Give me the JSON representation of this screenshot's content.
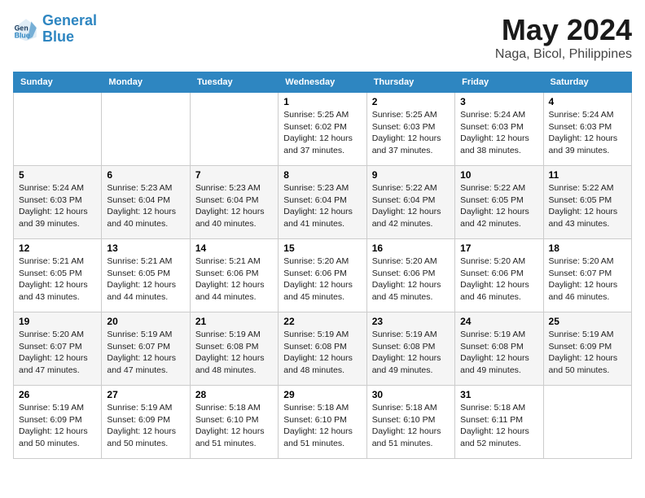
{
  "logo": {
    "line1": "General",
    "line2": "Blue"
  },
  "title": "May 2024",
  "subtitle": "Naga, Bicol, Philippines",
  "headers": [
    "Sunday",
    "Monday",
    "Tuesday",
    "Wednesday",
    "Thursday",
    "Friday",
    "Saturday"
  ],
  "weeks": [
    [
      {
        "day": "",
        "info": ""
      },
      {
        "day": "",
        "info": ""
      },
      {
        "day": "",
        "info": ""
      },
      {
        "day": "1",
        "info": "Sunrise: 5:25 AM\nSunset: 6:02 PM\nDaylight: 12 hours\nand 37 minutes."
      },
      {
        "day": "2",
        "info": "Sunrise: 5:25 AM\nSunset: 6:03 PM\nDaylight: 12 hours\nand 37 minutes."
      },
      {
        "day": "3",
        "info": "Sunrise: 5:24 AM\nSunset: 6:03 PM\nDaylight: 12 hours\nand 38 minutes."
      },
      {
        "day": "4",
        "info": "Sunrise: 5:24 AM\nSunset: 6:03 PM\nDaylight: 12 hours\nand 39 minutes."
      }
    ],
    [
      {
        "day": "5",
        "info": "Sunrise: 5:24 AM\nSunset: 6:03 PM\nDaylight: 12 hours\nand 39 minutes."
      },
      {
        "day": "6",
        "info": "Sunrise: 5:23 AM\nSunset: 6:04 PM\nDaylight: 12 hours\nand 40 minutes."
      },
      {
        "day": "7",
        "info": "Sunrise: 5:23 AM\nSunset: 6:04 PM\nDaylight: 12 hours\nand 40 minutes."
      },
      {
        "day": "8",
        "info": "Sunrise: 5:23 AM\nSunset: 6:04 PM\nDaylight: 12 hours\nand 41 minutes."
      },
      {
        "day": "9",
        "info": "Sunrise: 5:22 AM\nSunset: 6:04 PM\nDaylight: 12 hours\nand 42 minutes."
      },
      {
        "day": "10",
        "info": "Sunrise: 5:22 AM\nSunset: 6:05 PM\nDaylight: 12 hours\nand 42 minutes."
      },
      {
        "day": "11",
        "info": "Sunrise: 5:22 AM\nSunset: 6:05 PM\nDaylight: 12 hours\nand 43 minutes."
      }
    ],
    [
      {
        "day": "12",
        "info": "Sunrise: 5:21 AM\nSunset: 6:05 PM\nDaylight: 12 hours\nand 43 minutes."
      },
      {
        "day": "13",
        "info": "Sunrise: 5:21 AM\nSunset: 6:05 PM\nDaylight: 12 hours\nand 44 minutes."
      },
      {
        "day": "14",
        "info": "Sunrise: 5:21 AM\nSunset: 6:06 PM\nDaylight: 12 hours\nand 44 minutes."
      },
      {
        "day": "15",
        "info": "Sunrise: 5:20 AM\nSunset: 6:06 PM\nDaylight: 12 hours\nand 45 minutes."
      },
      {
        "day": "16",
        "info": "Sunrise: 5:20 AM\nSunset: 6:06 PM\nDaylight: 12 hours\nand 45 minutes."
      },
      {
        "day": "17",
        "info": "Sunrise: 5:20 AM\nSunset: 6:06 PM\nDaylight: 12 hours\nand 46 minutes."
      },
      {
        "day": "18",
        "info": "Sunrise: 5:20 AM\nSunset: 6:07 PM\nDaylight: 12 hours\nand 46 minutes."
      }
    ],
    [
      {
        "day": "19",
        "info": "Sunrise: 5:20 AM\nSunset: 6:07 PM\nDaylight: 12 hours\nand 47 minutes."
      },
      {
        "day": "20",
        "info": "Sunrise: 5:19 AM\nSunset: 6:07 PM\nDaylight: 12 hours\nand 47 minutes."
      },
      {
        "day": "21",
        "info": "Sunrise: 5:19 AM\nSunset: 6:08 PM\nDaylight: 12 hours\nand 48 minutes."
      },
      {
        "day": "22",
        "info": "Sunrise: 5:19 AM\nSunset: 6:08 PM\nDaylight: 12 hours\nand 48 minutes."
      },
      {
        "day": "23",
        "info": "Sunrise: 5:19 AM\nSunset: 6:08 PM\nDaylight: 12 hours\nand 49 minutes."
      },
      {
        "day": "24",
        "info": "Sunrise: 5:19 AM\nSunset: 6:08 PM\nDaylight: 12 hours\nand 49 minutes."
      },
      {
        "day": "25",
        "info": "Sunrise: 5:19 AM\nSunset: 6:09 PM\nDaylight: 12 hours\nand 50 minutes."
      }
    ],
    [
      {
        "day": "26",
        "info": "Sunrise: 5:19 AM\nSunset: 6:09 PM\nDaylight: 12 hours\nand 50 minutes."
      },
      {
        "day": "27",
        "info": "Sunrise: 5:19 AM\nSunset: 6:09 PM\nDaylight: 12 hours\nand 50 minutes."
      },
      {
        "day": "28",
        "info": "Sunrise: 5:18 AM\nSunset: 6:10 PM\nDaylight: 12 hours\nand 51 minutes."
      },
      {
        "day": "29",
        "info": "Sunrise: 5:18 AM\nSunset: 6:10 PM\nDaylight: 12 hours\nand 51 minutes."
      },
      {
        "day": "30",
        "info": "Sunrise: 5:18 AM\nSunset: 6:10 PM\nDaylight: 12 hours\nand 51 minutes."
      },
      {
        "day": "31",
        "info": "Sunrise: 5:18 AM\nSunset: 6:11 PM\nDaylight: 12 hours\nand 52 minutes."
      },
      {
        "day": "",
        "info": ""
      }
    ]
  ]
}
